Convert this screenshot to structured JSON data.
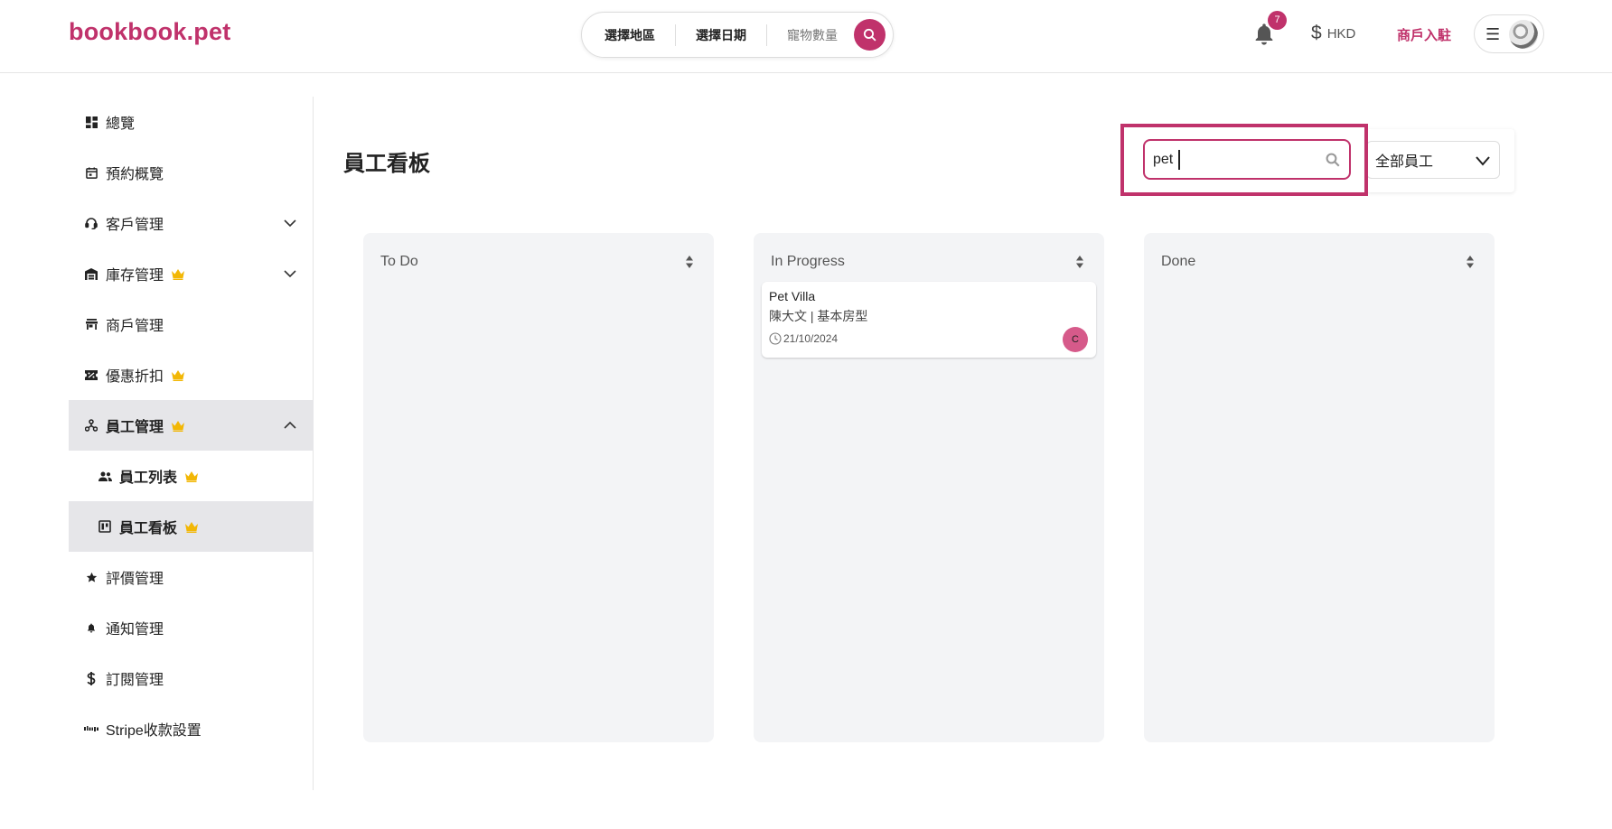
{
  "header": {
    "logo": "bookbook.pet",
    "search": {
      "region": "選擇地區",
      "date": "選擇日期",
      "pets": "寵物數量"
    },
    "notification_count": "7",
    "currency_symbol": "$",
    "currency": "HKD",
    "merchant_link": "商戶入駐",
    "menu_glyph": "☰"
  },
  "sidebar": {
    "items": [
      {
        "label": "總覽",
        "icon": "dashboard-icon"
      },
      {
        "label": "預約概覽",
        "icon": "calendar-icon"
      },
      {
        "label": "客戶管理",
        "icon": "headset-icon"
      },
      {
        "label": "庫存管理",
        "icon": "warehouse-icon"
      },
      {
        "label": "商戶管理",
        "icon": "store-icon"
      },
      {
        "label": "優惠折扣",
        "icon": "coupon-icon"
      },
      {
        "label": "員工管理",
        "icon": "org-chart-icon"
      },
      {
        "label": "員工列表",
        "icon": "people-icon"
      },
      {
        "label": "員工看板",
        "icon": "kanban-icon"
      },
      {
        "label": "評價管理",
        "icon": "star-icon"
      },
      {
        "label": "通知管理",
        "icon": "bell-icon"
      },
      {
        "label": "訂閱管理",
        "icon": "dollar-icon"
      },
      {
        "label": "Stripe收款設置",
        "icon": "stripe-icon"
      }
    ]
  },
  "main": {
    "title": "員工看板",
    "search_value": "pet",
    "staff_filter": "全部員工"
  },
  "board": {
    "columns": [
      {
        "title": "To Do",
        "cards": []
      },
      {
        "title": "In Progress",
        "cards": [
          {
            "title": "Pet Villa",
            "subtitle": "陳大文 | 基本房型",
            "date": "21/10/2024",
            "assignee": "C"
          }
        ]
      },
      {
        "title": "Done",
        "cards": []
      }
    ]
  },
  "colors": {
    "brand": "#c0326b",
    "crown": "#f2b705",
    "active_bg": "#e6e6e9",
    "column_bg": "#f3f4f6"
  }
}
